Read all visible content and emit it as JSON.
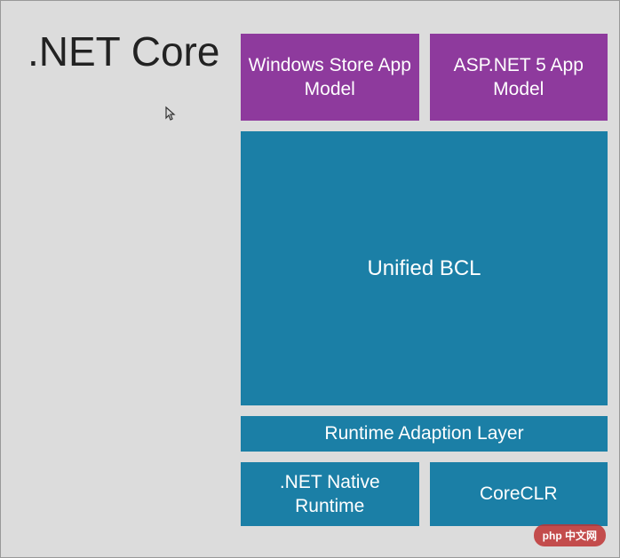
{
  "title": ".NET Core",
  "blocks": {
    "windows_store": "Windows Store App Model",
    "aspnet": "ASP.NET 5 App Model",
    "bcl": "Unified BCL",
    "adaption": "Runtime Adaption Layer",
    "native_runtime": ".NET Native Runtime",
    "coreclr": "CoreCLR"
  },
  "watermark": "php 中文网",
  "colors": {
    "purple": "#8e3a9d",
    "blue": "#1b7fa6",
    "background": "#dcdcdc"
  }
}
